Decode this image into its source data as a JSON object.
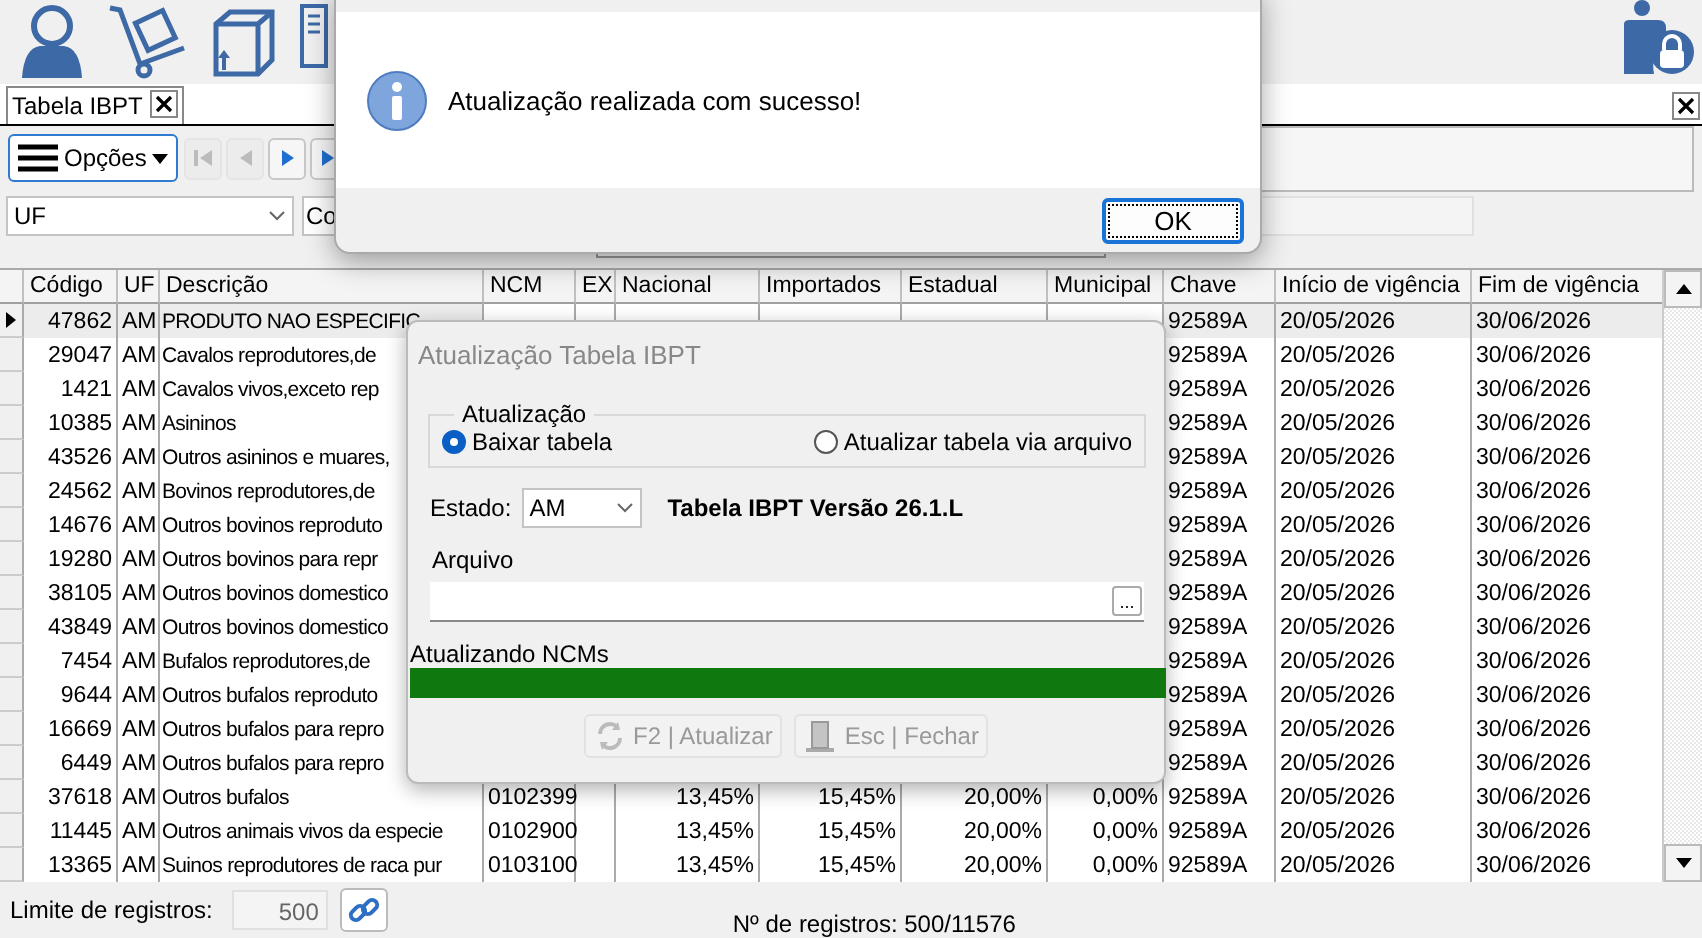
{
  "toolbar": {
    "icons": [
      {
        "kind": "person"
      },
      {
        "kind": "handtruck"
      },
      {
        "kind": "box"
      },
      {
        "kind": "document"
      }
    ],
    "right_icon": {
      "kind": "userlock"
    }
  },
  "tabs": [
    {
      "label": "Tabela IBPT",
      "selected": true
    }
  ],
  "options_button": {
    "label": "Opções"
  },
  "nav_buttons": [
    {
      "kind": "first",
      "disabled": true
    },
    {
      "kind": "prev",
      "disabled": true
    },
    {
      "kind": "next",
      "disabled": false
    },
    {
      "kind": "last",
      "disabled": false
    }
  ],
  "filters": {
    "uf": "UF",
    "second": "Co"
  },
  "table": {
    "columns": [
      "Código",
      "UF",
      "Descrição",
      "NCM",
      "EX",
      "Nacional",
      "Importados",
      "Estadual",
      "Municipal",
      "Chave",
      "Início de vigência",
      "Fim de vigência"
    ],
    "rows": [
      {
        "selected": true,
        "codigo": "47862",
        "uf": "AM",
        "descricao": "PRODUTO NAO ESPECIFIC",
        "chave": "92589A",
        "inicio": "20/05/2026",
        "fim": "30/06/2026"
      },
      {
        "selected": false,
        "codigo": "29047",
        "uf": "AM",
        "descricao": "Cavalos reprodutores,de",
        "chave": "92589A",
        "inicio": "20/05/2026",
        "fim": "30/06/2026"
      },
      {
        "selected": false,
        "codigo": "1421",
        "uf": "AM",
        "descricao": "Cavalos vivos,exceto rep",
        "chave": "92589A",
        "inicio": "20/05/2026",
        "fim": "30/06/2026"
      },
      {
        "selected": false,
        "codigo": "10385",
        "uf": "AM",
        "descricao": "Asininos",
        "chave": "92589A",
        "inicio": "20/05/2026",
        "fim": "30/06/2026"
      },
      {
        "selected": false,
        "codigo": "43526",
        "uf": "AM",
        "descricao": "Outros asininos e muares,",
        "chave": "92589A",
        "inicio": "20/05/2026",
        "fim": "30/06/2026"
      },
      {
        "selected": false,
        "codigo": "24562",
        "uf": "AM",
        "descricao": "Bovinos reprodutores,de",
        "chave": "92589A",
        "inicio": "20/05/2026",
        "fim": "30/06/2026"
      },
      {
        "selected": false,
        "codigo": "14676",
        "uf": "AM",
        "descricao": "Outros bovinos reproduto",
        "chave": "92589A",
        "inicio": "20/05/2026",
        "fim": "30/06/2026"
      },
      {
        "selected": false,
        "codigo": "19280",
        "uf": "AM",
        "descricao": "Outros bovinos para repr",
        "chave": "92589A",
        "inicio": "20/05/2026",
        "fim": "30/06/2026"
      },
      {
        "selected": false,
        "codigo": "38105",
        "uf": "AM",
        "descricao": "Outros bovinos domestico",
        "chave": "92589A",
        "inicio": "20/05/2026",
        "fim": "30/06/2026"
      },
      {
        "selected": false,
        "codigo": "43849",
        "uf": "AM",
        "descricao": "Outros bovinos domestico",
        "chave": "92589A",
        "inicio": "20/05/2026",
        "fim": "30/06/2026"
      },
      {
        "selected": false,
        "codigo": "7454",
        "uf": "AM",
        "descricao": "Bufalos reprodutores,de",
        "chave": "92589A",
        "inicio": "20/05/2026",
        "fim": "30/06/2026"
      },
      {
        "selected": false,
        "codigo": "9644",
        "uf": "AM",
        "descricao": "Outros bufalos reproduto",
        "chave": "92589A",
        "inicio": "20/05/2026",
        "fim": "30/06/2026"
      },
      {
        "selected": false,
        "codigo": "16669",
        "uf": "AM",
        "descricao": "Outros bufalos para repro",
        "chave": "92589A",
        "inicio": "20/05/2026",
        "fim": "30/06/2026"
      },
      {
        "selected": false,
        "codigo": "6449",
        "uf": "AM",
        "descricao": "Outros bufalos para repro",
        "chave": "92589A",
        "inicio": "20/05/2026",
        "fim": "30/06/2026"
      },
      {
        "selected": false,
        "codigo": "37618",
        "uf": "AM",
        "descricao": "Outros bufalos",
        "ncm": "0102399",
        "nacional": "13,45%",
        "importados": "15,45%",
        "estadual": "20,00%",
        "municipal": "0,00%",
        "chave": "92589A",
        "inicio": "20/05/2026",
        "fim": "30/06/2026"
      },
      {
        "selected": false,
        "codigo": "11445",
        "uf": "AM",
        "descricao": "Outros animais vivos da especie",
        "ncm": "0102900",
        "nacional": "13,45%",
        "importados": "15,45%",
        "estadual": "20,00%",
        "municipal": "0,00%",
        "chave": "92589A",
        "inicio": "20/05/2026",
        "fim": "30/06/2026"
      },
      {
        "selected": false,
        "codigo": "13365",
        "uf": "AM",
        "descricao": "Suinos reprodutores de raca pur",
        "ncm": "0103100",
        "nacional": "13,45%",
        "importados": "15,45%",
        "estadual": "20,00%",
        "municipal": "0,00%",
        "chave": "92589A",
        "inicio": "20/05/2026",
        "fim": "30/06/2026"
      }
    ]
  },
  "footer": {
    "limit_label": "Limite de registros:",
    "limit_value": "500",
    "count": "Nº de registros: 500/11576"
  },
  "message_box": {
    "text": "Atualização realizada com sucesso!",
    "button": "OK"
  },
  "ibpt_dialog": {
    "title": "Atualização Tabela IBPT",
    "group_title": "Atualização",
    "options": [
      {
        "label": "Baixar tabela",
        "selected": true
      },
      {
        "label": "Atualizar tabela via arquivo",
        "selected": false
      }
    ],
    "estado_label": "Estado:",
    "estado_value": "AM",
    "version": "Tabela IBPT Versão 26.1.L",
    "arquivo_label": "Arquivo",
    "browse": "...",
    "progress_label": "Atualizando NCMs",
    "progress": {
      "level": 1
    },
    "buttons": [
      {
        "kind": "refresh",
        "label": "F2 | Atualizar",
        "disabled": true
      },
      {
        "kind": "door",
        "label": "Esc | Fechar",
        "disabled": true
      }
    ]
  }
}
